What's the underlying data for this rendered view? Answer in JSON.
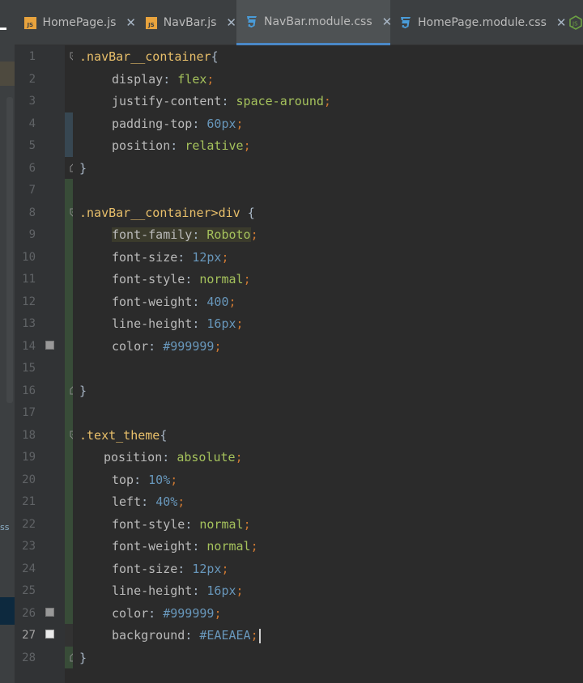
{
  "tabs": [
    {
      "label": "HomePage.js",
      "type": "js",
      "active": false
    },
    {
      "label": "NavBar.js",
      "type": "js",
      "active": false
    },
    {
      "label": "NavBar.module.css",
      "type": "css",
      "active": true
    },
    {
      "label": "HomePage.module.css",
      "type": "css",
      "active": false
    }
  ],
  "left_panel": {
    "fragment": "ss"
  },
  "colors": {
    "swatch_999999": "#999999",
    "swatch_EAEAEA": "#EAEAEA",
    "accent": "#4A88C7"
  },
  "code": {
    "l1": {
      "num": "1",
      "sel": ".navBar__container",
      "brace": "{"
    },
    "l2": {
      "num": "2",
      "prop": "display",
      "val": "flex"
    },
    "l3": {
      "num": "3",
      "prop": "justify-content",
      "val": "space-around"
    },
    "l4": {
      "num": "4",
      "prop": "padding-top",
      "val_num": "60",
      "val_unit": "px"
    },
    "l5": {
      "num": "5",
      "prop": "position",
      "val": "relative"
    },
    "l6": {
      "num": "6",
      "brace": "}"
    },
    "l7": {
      "num": "7"
    },
    "l8": {
      "num": "8",
      "sel": ".navBar__container>div",
      "brace": "{"
    },
    "l9": {
      "num": "9",
      "prop": "font-family",
      "val": "Roboto"
    },
    "l10": {
      "num": "10",
      "prop": "font-size",
      "val_num": "12",
      "val_unit": "px"
    },
    "l11": {
      "num": "11",
      "prop": "font-style",
      "val": "normal"
    },
    "l12": {
      "num": "12",
      "prop": "font-weight",
      "val_num": "400"
    },
    "l13": {
      "num": "13",
      "prop": "line-height",
      "val_num": "16",
      "val_unit": "px"
    },
    "l14": {
      "num": "14",
      "prop": "color",
      "val_hex": "#999999"
    },
    "l15": {
      "num": "15"
    },
    "l16": {
      "num": "16",
      "brace": "}"
    },
    "l17": {
      "num": "17"
    },
    "l18": {
      "num": "18",
      "sel": ".text_theme",
      "brace": "{"
    },
    "l19": {
      "num": "19",
      "prop": "position",
      "val": "absolute"
    },
    "l20": {
      "num": "20",
      "prop": "top",
      "val_num": "10",
      "val_unit": "%"
    },
    "l21": {
      "num": "21",
      "prop": "left",
      "val_num": "40",
      "val_unit": "%"
    },
    "l22": {
      "num": "22",
      "prop": "font-style",
      "val": "normal"
    },
    "l23": {
      "num": "23",
      "prop": "font-weight",
      "val": "normal"
    },
    "l24": {
      "num": "24",
      "prop": "font-size",
      "val_num": "12",
      "val_unit": "px"
    },
    "l25": {
      "num": "25",
      "prop": "line-height",
      "val_num": "16",
      "val_unit": "px"
    },
    "l26": {
      "num": "26",
      "prop": "color",
      "val_hex": "#999999"
    },
    "l27": {
      "num": "27",
      "prop": "background",
      "val_hex": "#EAEAEA"
    },
    "l28": {
      "num": "28",
      "brace": "}"
    }
  },
  "icons": {
    "js": "js-file-icon",
    "css": "css-file-icon",
    "node": "nodejs-icon",
    "close": "close-icon",
    "bulb": "lightbulb-icon",
    "fold": "fold-marker-icon"
  }
}
